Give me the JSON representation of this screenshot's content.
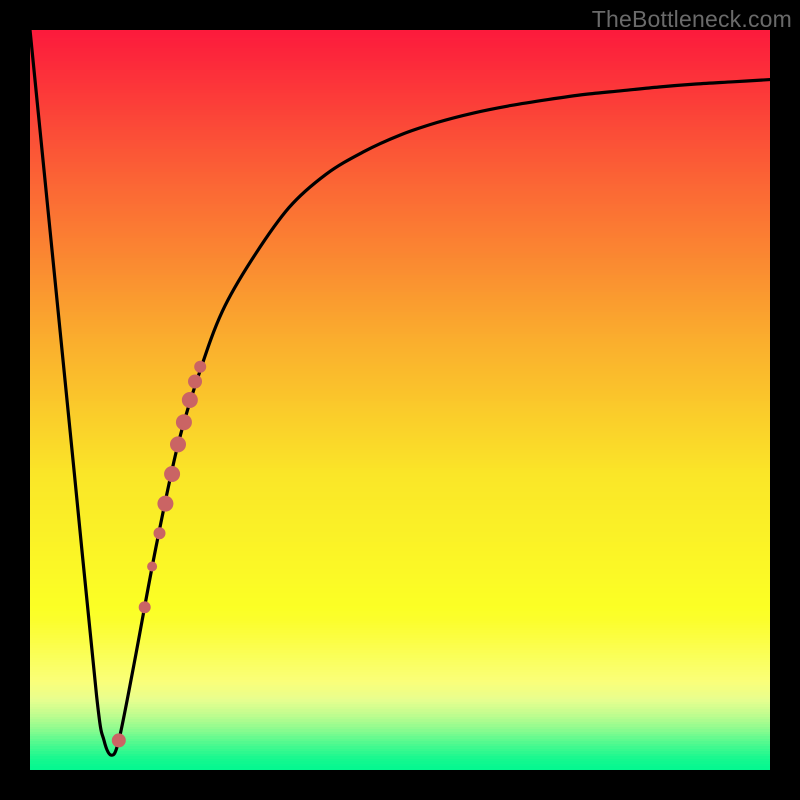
{
  "watermark": "TheBottleneck.com",
  "colors": {
    "frame": "#000000",
    "curve": "#000000",
    "marker": "#ca6464",
    "watermark": "#6a6a6a"
  },
  "chart_data": {
    "type": "line",
    "title": "",
    "xlabel": "",
    "ylabel": "",
    "xlim": [
      0,
      100
    ],
    "ylim": [
      0,
      100
    ],
    "grid": false,
    "legend": false,
    "gradient_stops": [
      {
        "pos": 0.0,
        "color": "#fc1b3c"
      },
      {
        "pos": 0.2,
        "color": "#fb6435"
      },
      {
        "pos": 0.4,
        "color": "#faa82e"
      },
      {
        "pos": 0.6,
        "color": "#fae628"
      },
      {
        "pos": 0.78,
        "color": "#fbff25"
      },
      {
        "pos": 0.8,
        "color": "#fbfe2e"
      },
      {
        "pos": 0.88,
        "color": "#faff79"
      },
      {
        "pos": 0.905,
        "color": "#e8fe8f"
      },
      {
        "pos": 0.925,
        "color": "#c1fd8f"
      },
      {
        "pos": 0.945,
        "color": "#8cfb8f"
      },
      {
        "pos": 0.965,
        "color": "#4ef98f"
      },
      {
        "pos": 0.985,
        "color": "#16f88f"
      },
      {
        "pos": 1.0,
        "color": "#03f890"
      }
    ],
    "series": [
      {
        "name": "bottleneck-curve",
        "x": [
          0,
          3,
          6,
          9,
          10,
          11,
          12,
          14,
          17,
          20,
          23,
          26,
          30,
          35,
          40,
          45,
          50,
          55,
          60,
          65,
          70,
          75,
          80,
          85,
          90,
          95,
          100
        ],
        "y": [
          100,
          70,
          40,
          10,
          4,
          2,
          4,
          14,
          30,
          44,
          54,
          62,
          69,
          76,
          80.5,
          83.5,
          85.8,
          87.5,
          88.8,
          89.8,
          90.6,
          91.3,
          91.8,
          92.3,
          92.7,
          93.0,
          93.3
        ]
      }
    ],
    "markers": [
      {
        "x": 12.0,
        "y": 4.0,
        "r": 7
      },
      {
        "x": 15.5,
        "y": 22.0,
        "r": 6
      },
      {
        "x": 16.5,
        "y": 27.5,
        "r": 5
      },
      {
        "x": 17.5,
        "y": 32.0,
        "r": 6
      },
      {
        "x": 18.3,
        "y": 36.0,
        "r": 8
      },
      {
        "x": 19.2,
        "y": 40.0,
        "r": 8
      },
      {
        "x": 20.0,
        "y": 44.0,
        "r": 8
      },
      {
        "x": 20.8,
        "y": 47.0,
        "r": 8
      },
      {
        "x": 21.6,
        "y": 50.0,
        "r": 8
      },
      {
        "x": 22.3,
        "y": 52.5,
        "r": 7
      },
      {
        "x": 23.0,
        "y": 54.5,
        "r": 6
      }
    ]
  }
}
